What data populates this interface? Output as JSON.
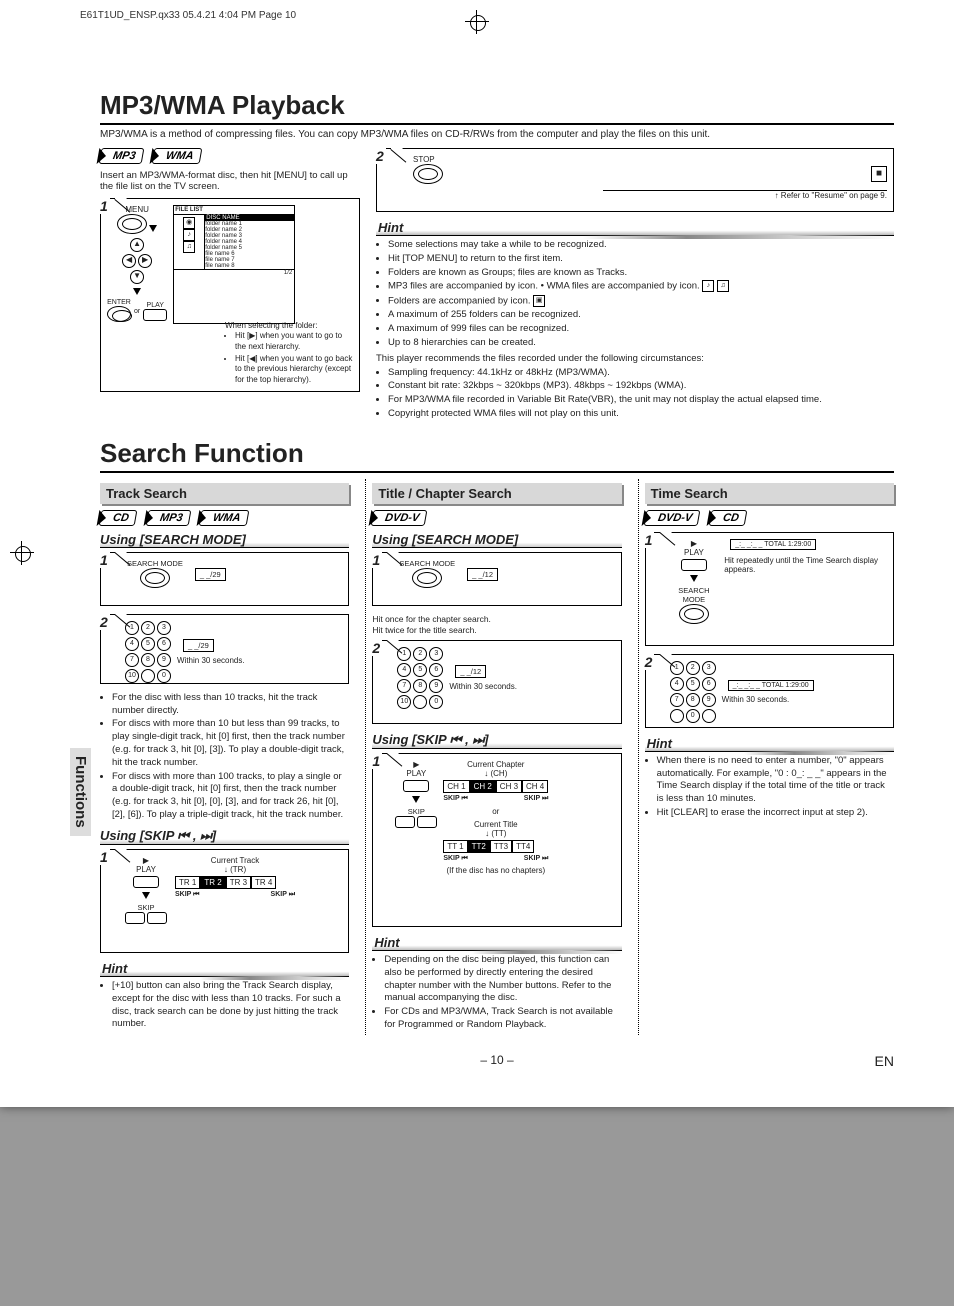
{
  "print_header": "E61T1UD_ENSP.qx33  05.4.21 4:04 PM  Page 10",
  "title1": "MP3/WMA Playback",
  "intro1": "MP3/WMA is a method of compressing files. You can copy MP3/WMA files on CD-R/RWs from the computer and play the files on this unit.",
  "badges_mp3": "MP3",
  "badges_wma": "WMA",
  "badges_cd": "CD",
  "badges_dvdv": "DVD-V",
  "insert_text": "Insert an MP3/WMA-format disc, then hit [MENU] to call up the file list on the TV screen.",
  "step1": {
    "label_menu": "MENU",
    "label_enter": "ENTER",
    "label_or": "or",
    "label_play": "PLAY",
    "panel_title": "FILE LIST",
    "panel_col": "DISC NAME",
    "panel_rows": [
      "folder name 1",
      "folder name 2",
      "folder name 3",
      "folder name 4",
      "folder name 5",
      "file name 6",
      "file name 7",
      "file name 8"
    ],
    "panel_foot": "1/2",
    "when_select": "When selecting the folder:",
    "bullet1": "Hit [▶] when you want to go to the next hierarchy.",
    "bullet2": "Hit [◀] when you want to go back to the previous hierarchy (except for the top hierarchy)."
  },
  "step2": {
    "label_stop": "STOP",
    "stop_sym": "■",
    "resume": "Refer to \"Resume\" on page 9."
  },
  "hint1_title": "Hint",
  "hint1": [
    "Some selections may take a while to be recognized.",
    "Hit [TOP MENU] to return to the first item.",
    "Folders are known as Groups; files are known as Tracks.",
    "MP3 files are accompanied by  icon.      • WMA files are accompanied by  icon.",
    "Folders are accompanied by  icon.",
    "A maximum of 255 folders can be recognized.",
    "A maximum of 999 files can be recognized.",
    "Up to 8 hierarchies can be created."
  ],
  "hint1_para": "This player recommends the files recorded under the following circumstances:",
  "hint1_more": [
    "Sampling frequency: 44.1kHz or 48kHz (MP3/WMA).",
    "Constant bit rate: 32kbps ~ 320kbps (MP3). 48kbps ~ 192kbps (WMA).",
    "For MP3/WMA file recorded in Variable Bit Rate(VBR), the unit may not display the actual elapsed time.",
    "Copyright protected WMA files will not play on this unit."
  ],
  "title2": "Search Function",
  "side_tab": "Functions",
  "track": {
    "head": "Track Search",
    "using1": "Using [SEARCH MODE]",
    "s1_label": "SEARCH MODE",
    "s1_osd": "_ _/29",
    "s2_within": "Within 30 seconds.",
    "s2_osd": "_ _/29",
    "bullets": [
      "For the disc with less than 10 tracks, hit the track number directly.",
      "For discs with more than 10 but less than 99 tracks, to play single-digit track, hit [0] first, then the track number (e.g. for track 3, hit [0], [3]). To play a double-digit track, hit the track number.",
      "For discs with more than 100 tracks, to play a single or a double-digit track, hit [0] first, then the track number (e.g. for track 3, hit [0], [0], [3], and for track 26, hit [0], [2], [6]). To play a triple-digit track, hit the track number."
    ],
    "using2": "Using [SKIP ⏮ , ⏭]",
    "skip_play": "PLAY",
    "skip_label": "SKIP",
    "skip_left": "SKIP ⏮",
    "skip_right": "SKIP ⏭",
    "cur_track": "Current Track",
    "cur_track_abbr": "(TR)",
    "tr_cells": [
      "TR 1",
      "TR 2",
      "TR 3",
      "TR 4"
    ],
    "hint_title": "Hint",
    "hint": "[+10] button can also bring the Track Search display, except for the disc with less than 10 tracks. For such a disc, track search can be done by just hitting the track number."
  },
  "title_chap": {
    "head": "Title / Chapter Search",
    "using1": "Using [SEARCH MODE]",
    "s1_label": "SEARCH MODE",
    "s1_osd": "_ _/12",
    "hit_once": "Hit once for the chapter search.",
    "hit_twice": "Hit twice for the title search.",
    "s2_osd": "_ _/12",
    "s2_within": "Within 30 seconds.",
    "using2": "Using [SKIP ⏮ , ⏭]",
    "play": "PLAY",
    "skip": "SKIP",
    "cur_chap": "Current Chapter",
    "cur_chap_abbr": "(CH)",
    "ch_cells": [
      "CH 1",
      "CH 2",
      "CH 3",
      "CH 4"
    ],
    "or": "or",
    "cur_title": "Current Title",
    "cur_title_abbr": "(TT)",
    "tt_cells": [
      "TT 1",
      "TT2",
      "TT3",
      "TT4"
    ],
    "nochap": "(If the disc has no chapters)",
    "hint_title": "Hint",
    "hint": [
      "Depending on the disc being played, this function can also be performed by directly entering the desired chapter number with the Number buttons. Refer to the manual accompanying the disc.",
      "For CDs and MP3/WMA, Track Search is not available for Programmed or Random Playback."
    ]
  },
  "time": {
    "head": "Time Search",
    "play": "PLAY",
    "srch": "SEARCH MODE",
    "osd1": "_:_ _:_ _  TOTAL 1:29:00",
    "hit_rep": "Hit repeatedly until the Time Search display appears.",
    "s2_within": "Within 30 seconds.",
    "osd2": "_:_ _:_ _  TOTAL 1:29:00",
    "hint_title": "Hint",
    "hint": [
      "When there is no need to enter a number, \"0\" appears automatically. For example, \"0 : 0_: _ _\" appears in the Time Search display if the total time of the title or track is less than 10 minutes.",
      "Hit [CLEAR] to erase the incorrect input at step 2)."
    ]
  },
  "page_num": "– 10 –",
  "lang": "EN"
}
